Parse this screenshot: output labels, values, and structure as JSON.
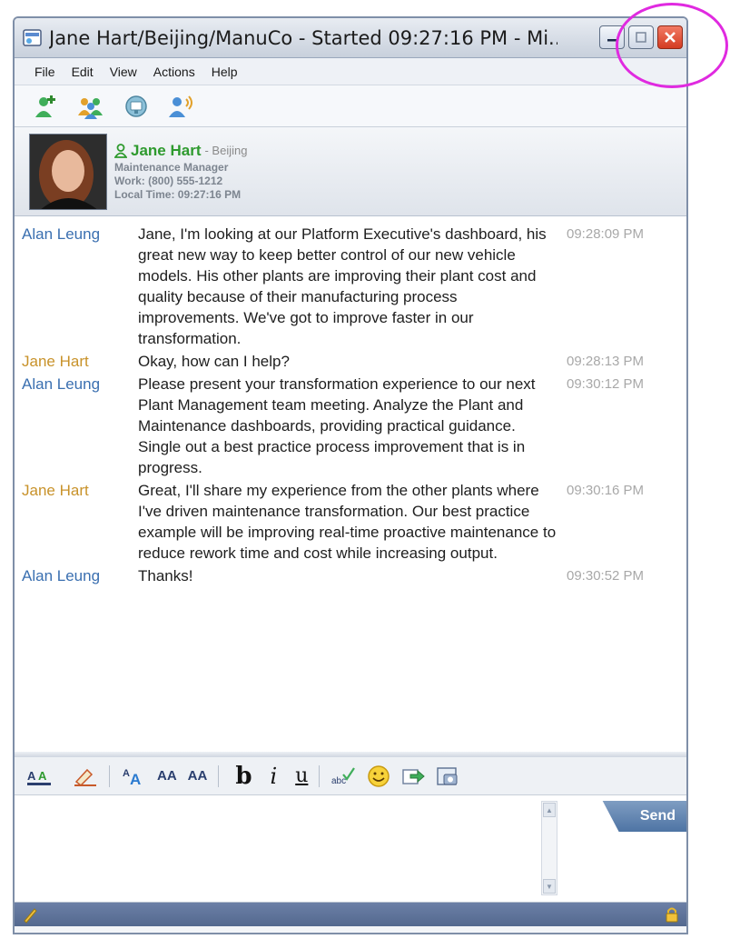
{
  "window": {
    "title": "Jane Hart/Beijing/ManuCo - Started 09:27:16 PM - Mi..."
  },
  "menu": [
    "File",
    "Edit",
    "View",
    "Actions",
    "Help"
  ],
  "toolbar_icons": [
    "add-contact-icon",
    "group-icon",
    "meeting-icon",
    "voice-call-icon"
  ],
  "contact": {
    "name": "Jane Hart",
    "location": "- Beijing",
    "title": "Maintenance Manager",
    "work": "Work: (800) 555-1212",
    "local_time": "Local Time: 09:27:16 PM",
    "status_icon": "online-person-icon"
  },
  "messages": [
    {
      "sender": "Alan Leung",
      "text": "Jane, I'm looking at our Platform Executive's dashboard, his great new way to keep better control of our new vehicle models.  His other plants are improving their plant cost and quality because of their manufacturing process improvements.   We've got to improve faster in our transformation.",
      "time": "09:28:09 PM"
    },
    {
      "sender": "Jane Hart",
      "text": "Okay, how can I help?",
      "time": "09:28:13 PM"
    },
    {
      "sender": "Alan Leung",
      "text": "Please present your transformation experience to our next Plant Management team meeting.  Analyze the Plant and Maintenance dashboards, providing practical guidance.    Single out a best practice process improvement that is in progress.",
      "time": "09:30:12 PM"
    },
    {
      "sender": "Jane Hart",
      "text": "Great, I'll share my experience from the other plants where I've driven maintenance transformation.   Our best practice example will be improving real-time proactive maintenance to reduce rework time and cost while increasing output.",
      "time": "09:30:16 PM"
    },
    {
      "sender": "Alan Leung",
      "text": "Thanks!",
      "time": "09:30:52 PM"
    }
  ],
  "format_bar": {
    "grow_font": "A",
    "size_large": "AA",
    "size_small": "AA",
    "bold": "b",
    "italic": "i",
    "underline": "u"
  },
  "compose": {
    "value": "",
    "send_label": "Send"
  },
  "colors": {
    "highlight": "#e02ae0",
    "alan": "#3a6fb0",
    "jane": "#c8922a",
    "online": "#2e9a2e"
  }
}
